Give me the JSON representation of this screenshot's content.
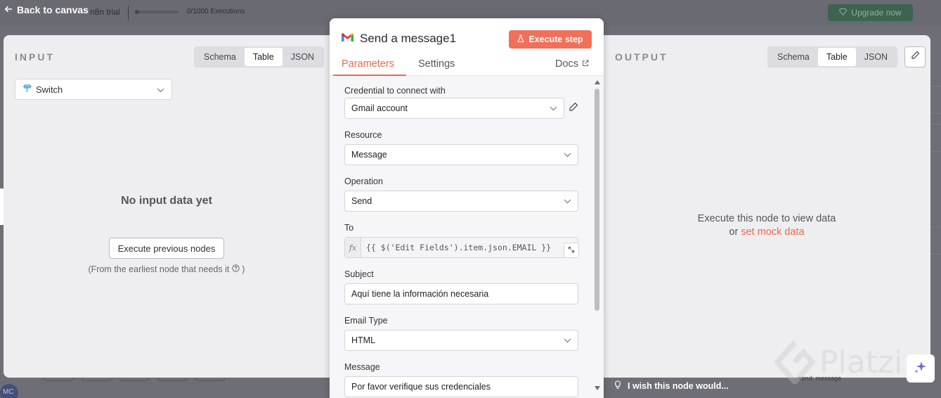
{
  "topbar": {
    "back_label": "Back to canvas",
    "trial_label": "n8n trial",
    "executions_label": "0/1000 Executions",
    "upgrade_label": "Upgrade now",
    "avatar_initials": "MC"
  },
  "input_panel": {
    "title": "INPUT",
    "view_tabs": [
      "Schema",
      "Table",
      "JSON"
    ],
    "active_view": "Table",
    "node_select_value": "Switch",
    "empty_title": "No input data yet",
    "execute_previous_label": "Execute previous nodes",
    "earliest_note": "(From the earliest node that needs it",
    "earliest_note_end": ")"
  },
  "dialog": {
    "title": "Send a message1",
    "execute_step_label": "Execute step",
    "tabs": [
      "Parameters",
      "Settings"
    ],
    "active_tab": "Parameters",
    "docs_label": "Docs",
    "fields": {
      "credential": {
        "label": "Credential to connect with",
        "value": "Gmail account"
      },
      "resource": {
        "label": "Resource",
        "value": "Message"
      },
      "operation": {
        "label": "Operation",
        "value": "Send"
      },
      "to": {
        "label": "To",
        "expression": "{{ $('Edit Fields').item.json.EMAIL }}",
        "fx_label": "fx"
      },
      "subject": {
        "label": "Subject",
        "value": "Aquí tiene la información necesaria"
      },
      "email_type": {
        "label": "Email Type",
        "value": "HTML"
      },
      "message": {
        "label": "Message",
        "value": "Por favor verifique sus credenciales"
      }
    }
  },
  "output_panel": {
    "title": "OUTPUT",
    "view_tabs": [
      "Schema",
      "Table",
      "JSON"
    ],
    "active_view": "Table",
    "message_line1": "Execute this node to view data",
    "message_or": "or",
    "mock_link": "set mock data"
  },
  "footer": {
    "wish_label": "I wish this node would...",
    "bg_node_label": "send: message"
  },
  "watermark": "Platzi",
  "colors": {
    "accent": "#ea6a4b",
    "execute_button": "#f0705a",
    "panel_bg": "#eeeef0",
    "overlay_bg": "#6e6e76"
  }
}
